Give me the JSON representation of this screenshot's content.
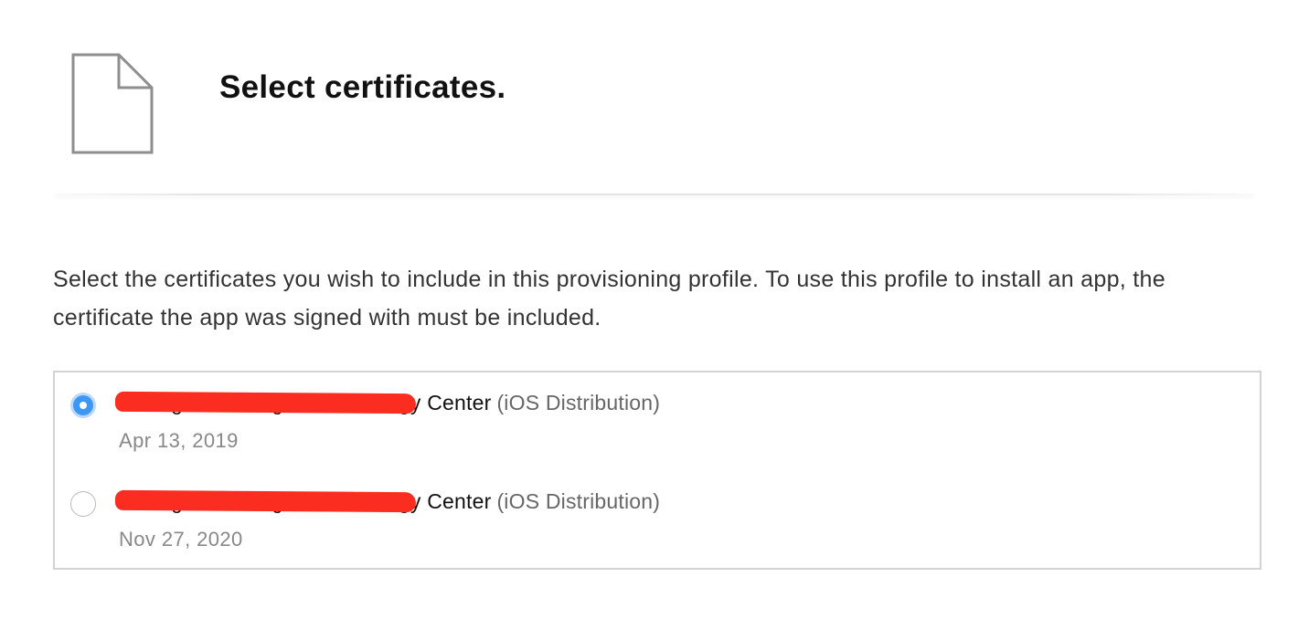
{
  "header": {
    "title": "Select certificates.",
    "icon": "document-icon"
  },
  "intro_text": "Select the certificates you wish to include in this provisioning profile. To use this profile to install an app, the certificate the app was signed with must be included.",
  "certificates": [
    {
      "name": "Guangzhou Weigao Technology Center",
      "type": "(iOS Distribution)",
      "date": "Apr 13, 2019",
      "selected": true
    },
    {
      "name": "Guangzhou Weigao Technology Center",
      "type": "(iOS Distribution)",
      "date": "Nov 27, 2020",
      "selected": false
    }
  ],
  "colors": {
    "radio_selected": "#3f97f5",
    "redaction": "#fb2c20"
  }
}
